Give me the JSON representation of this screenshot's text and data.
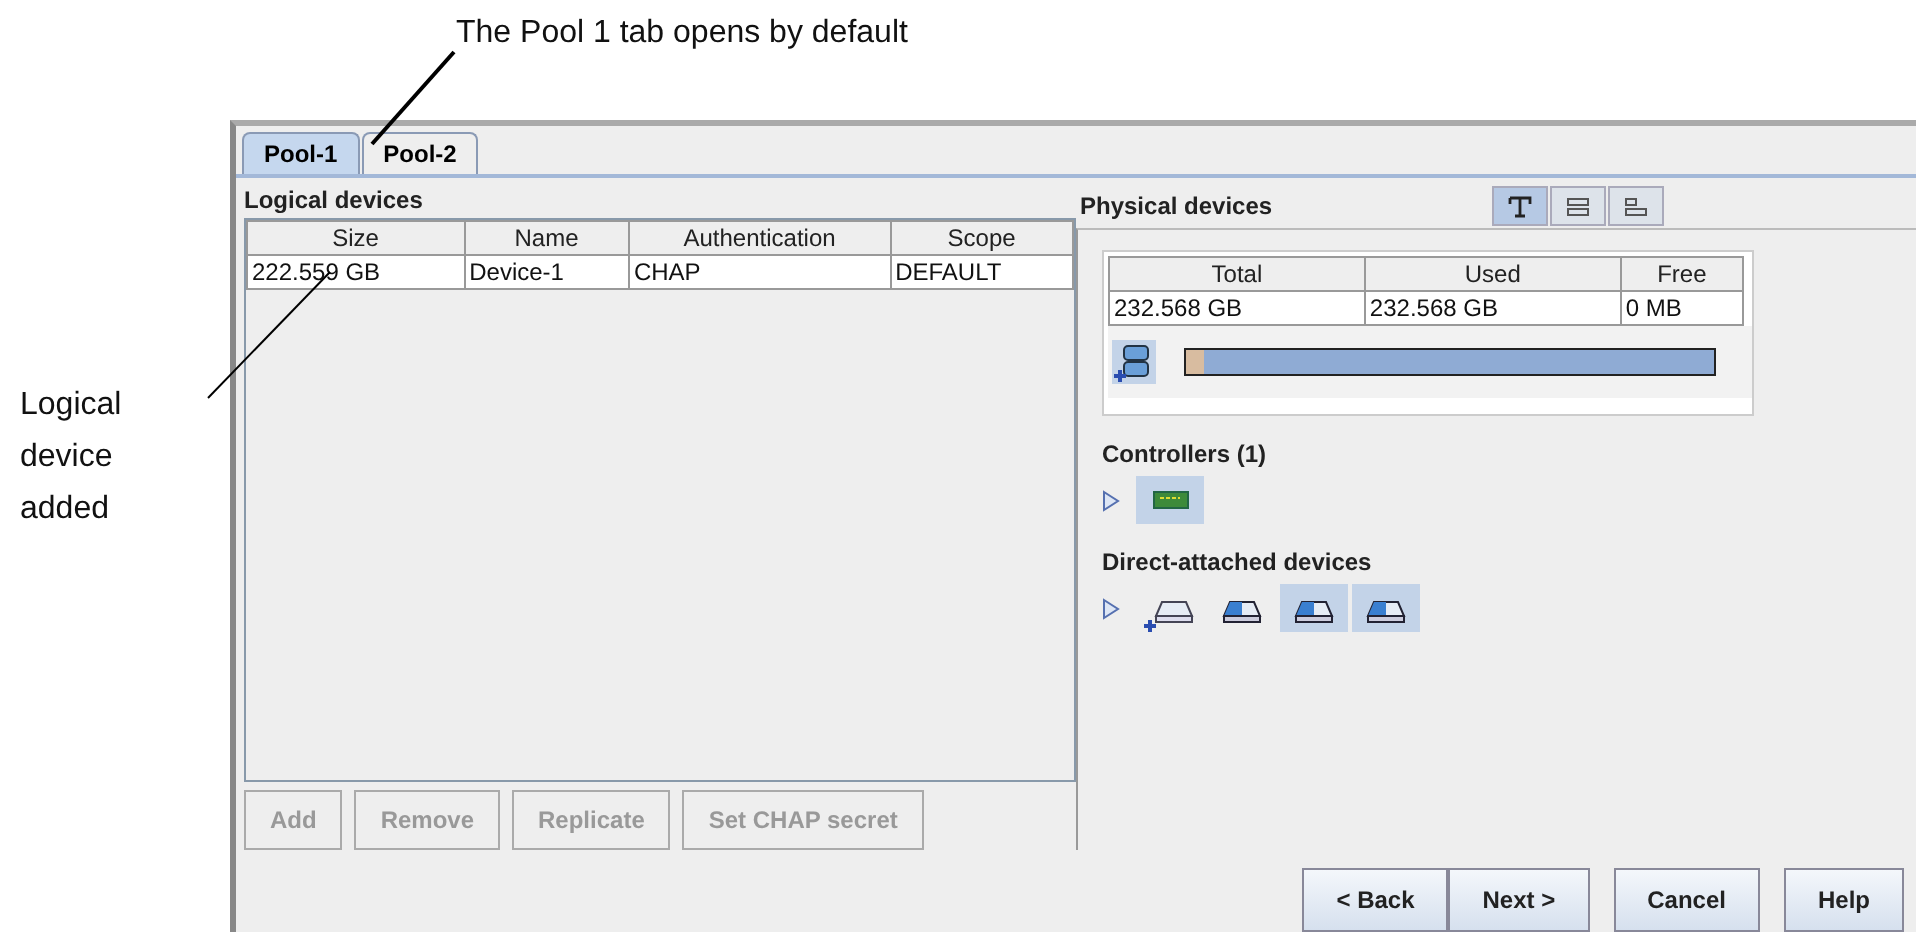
{
  "callouts": [
    {
      "text": "The Pool 1 tab opens by default"
    },
    {
      "text": "Logical device added"
    }
  ],
  "tabs": [
    {
      "label": "Pool-1",
      "selected": true
    },
    {
      "label": "Pool-2",
      "selected": false
    }
  ],
  "logical_devices": {
    "title": "Logical devices",
    "columns": [
      "Size",
      "Name",
      "Authentication",
      "Scope"
    ],
    "rows": [
      [
        "222.559 GB",
        "Device-1",
        "CHAP",
        "DEFAULT"
      ]
    ],
    "buttons": [
      {
        "label": "Add",
        "disabled": true
      },
      {
        "label": "Remove",
        "disabled": true
      },
      {
        "label": "Replicate",
        "disabled": true
      },
      {
        "label": "Set CHAP secret",
        "disabled": true
      }
    ]
  },
  "physical_devices": {
    "title": "Physical devices",
    "view_buttons": [
      {
        "kind": "text",
        "selected": true
      },
      {
        "kind": "rows",
        "selected": false
      },
      {
        "kind": "compact",
        "selected": false
      }
    ],
    "columns": [
      "Total",
      "Used",
      "Free"
    ],
    "row": [
      "232.568 GB",
      "232.568 GB",
      "0 MB"
    ],
    "usage": {
      "level": 0.035
    },
    "controllers": {
      "title": "Controllers (1)",
      "expanded": false,
      "items": [
        {
          "selected": true
        }
      ]
    },
    "direct_attached": {
      "title": "Direct-attached devices",
      "expanded": false,
      "items": [
        {
          "kind": "add",
          "selected": false
        },
        {
          "kind": "disk",
          "selected": false
        },
        {
          "kind": "disk",
          "selected": true
        },
        {
          "kind": "disk",
          "selected": true
        }
      ]
    }
  },
  "nav_buttons": [
    "< Back",
    "Next >",
    "Cancel",
    "Help"
  ]
}
